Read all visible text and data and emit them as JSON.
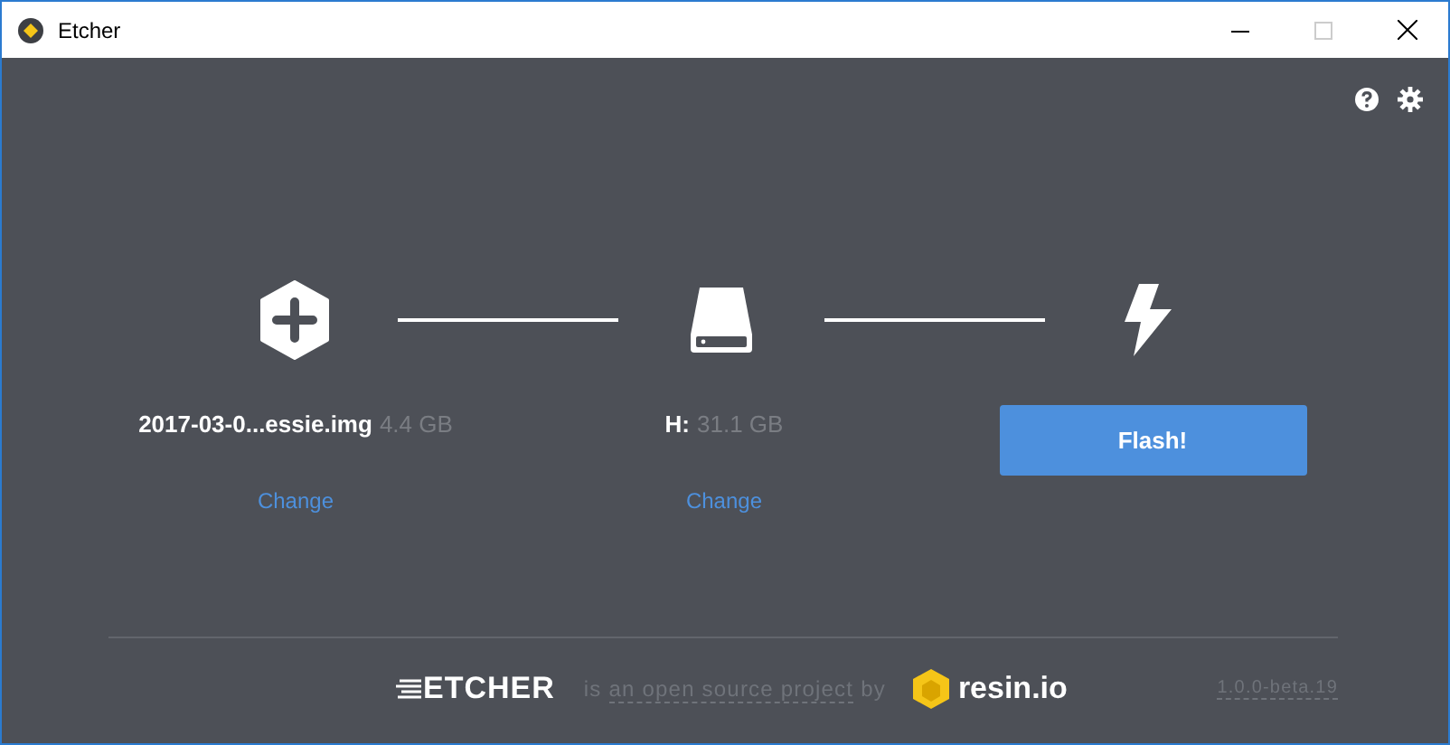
{
  "window": {
    "title": "Etcher"
  },
  "steps": [
    {
      "kind": "image",
      "name": "2017-03-0...essie.img",
      "size": "4.4 GB",
      "action": "Change"
    },
    {
      "kind": "drive",
      "name": "H:",
      "size": "31.1 GB",
      "action": "Change"
    },
    {
      "kind": "flash",
      "button": "Flash!"
    }
  ],
  "footer": {
    "logo": "ETCHER",
    "text_before": "is",
    "link": "an open source project",
    "text_after": "by",
    "brand": "resin.io",
    "version": "1.0.0-beta.19"
  }
}
